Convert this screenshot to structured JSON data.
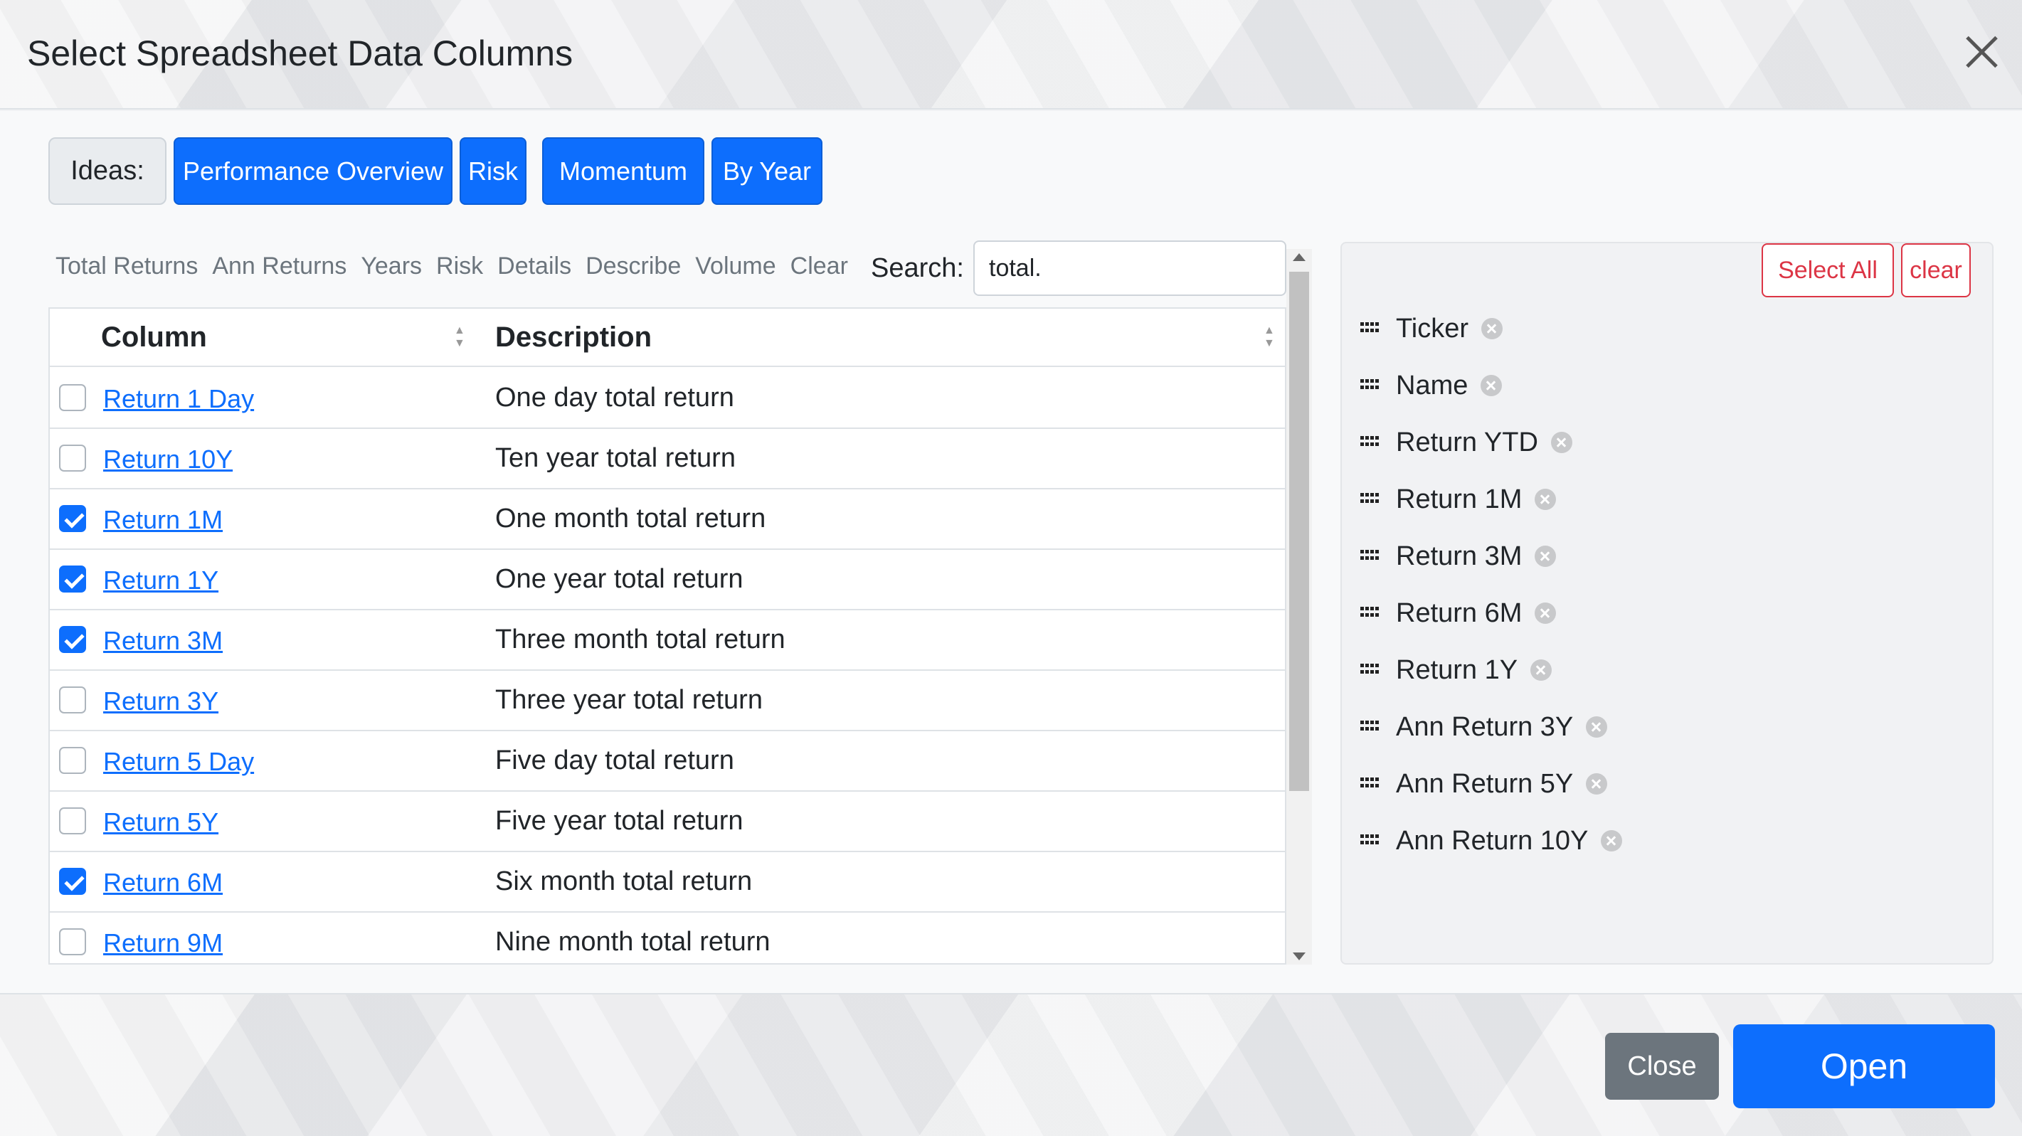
{
  "dialog": {
    "title": "Select Spreadsheet Data Columns",
    "close_icon": "close-icon"
  },
  "ideas": {
    "label": "Ideas:",
    "buttons": [
      "Performance Overview",
      "Risk",
      "Momentum",
      "By Year"
    ]
  },
  "filters": [
    "Total Returns",
    "Ann Returns",
    "Years",
    "Risk",
    "Details",
    "Describe",
    "Volume",
    "Clear"
  ],
  "search": {
    "label": "Search:",
    "value": "total."
  },
  "table": {
    "headers": {
      "column": "Column",
      "description": "Description"
    },
    "rows": [
      {
        "name": "Return 1 Day",
        "description": "One day total return",
        "checked": false
      },
      {
        "name": "Return 10Y",
        "description": "Ten year total return",
        "checked": false
      },
      {
        "name": "Return 1M",
        "description": "One month total return",
        "checked": true
      },
      {
        "name": "Return 1Y",
        "description": "One year total return",
        "checked": true
      },
      {
        "name": "Return 3M",
        "description": "Three month total return",
        "checked": true
      },
      {
        "name": "Return 3Y",
        "description": "Three year total return",
        "checked": false
      },
      {
        "name": "Return 5 Day",
        "description": "Five day total return",
        "checked": false
      },
      {
        "name": "Return 5Y",
        "description": "Five year total return",
        "checked": false
      },
      {
        "name": "Return 6M",
        "description": "Six month total return",
        "checked": true
      },
      {
        "name": "Return 9M",
        "description": "Nine month total return",
        "checked": false
      }
    ]
  },
  "selected": {
    "select_all_label": "Select All",
    "clear_label": "clear",
    "items": [
      "Ticker",
      "Name",
      "Return YTD",
      "Return 1M",
      "Return 3M",
      "Return 6M",
      "Return 1Y",
      "Ann Return 3Y",
      "Ann Return 5Y",
      "Ann Return 10Y"
    ]
  },
  "footer": {
    "close_label": "Close",
    "open_label": "Open"
  },
  "colors": {
    "primary": "#0d6efd",
    "danger": "#dc3545",
    "secondary": "#6c757d"
  }
}
